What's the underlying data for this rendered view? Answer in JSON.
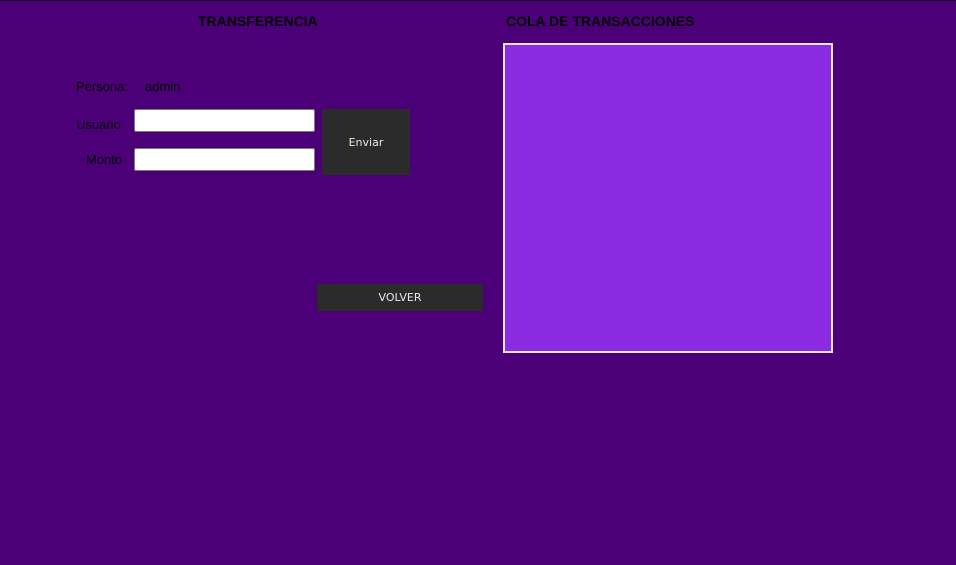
{
  "transfer": {
    "title": "TRANSFERENCIA",
    "persona_label": "Persona:",
    "persona_value": "admin",
    "usuario_label": "Usuario",
    "usuario_value": "",
    "monto_label": "Monto",
    "monto_value": "",
    "send_label": "Enviar",
    "back_label": "VOLVER"
  },
  "queue": {
    "title": "COLA DE TRANSACCIONES",
    "items": []
  },
  "colors": {
    "background": "#4b0077",
    "panel": "#8a2be2",
    "button": "#2b2b2b"
  }
}
